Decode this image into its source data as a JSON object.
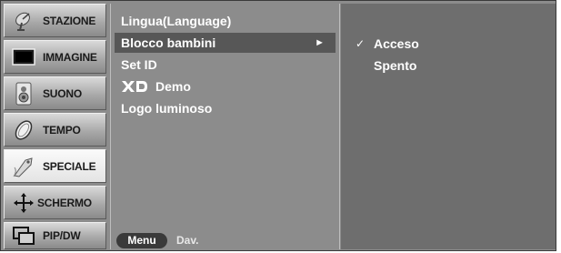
{
  "sidebar": {
    "items": [
      {
        "label": "STAZIONE",
        "icon": "satellite-dish-icon"
      },
      {
        "label": "IMMAGINE",
        "icon": "tv-screen-icon"
      },
      {
        "label": "SUONO",
        "icon": "speaker-icon"
      },
      {
        "label": "TEMPO",
        "icon": "clock-icon"
      },
      {
        "label": "SPECIALE",
        "icon": "tag-icon"
      },
      {
        "label": "SCHERMO",
        "icon": "move-arrows-icon"
      },
      {
        "label": "PIP/DW",
        "icon": "picture-in-picture-icon"
      }
    ],
    "active_index": 4
  },
  "menu": {
    "items": [
      {
        "label": "Lingua(Language)"
      },
      {
        "label": "Blocco bambini"
      },
      {
        "label": "Set ID"
      },
      {
        "label": "Demo",
        "prefix_logo": "XD"
      },
      {
        "label": "Logo luminoso"
      }
    ],
    "selected_index": 1,
    "selected_arrow": "►"
  },
  "options": {
    "items": [
      {
        "label": "Acceso",
        "checked": true,
        "check_mark": "✓"
      },
      {
        "label": "Spento",
        "checked": false
      }
    ]
  },
  "footer": {
    "menu_button": "Menu",
    "hint": "Dav."
  },
  "colors": {
    "panel_gray": "#8c8c8c",
    "options_bg": "#6e6e6e",
    "selection_bg": "#575757",
    "active_tab_bg": "#f0f0f0"
  }
}
